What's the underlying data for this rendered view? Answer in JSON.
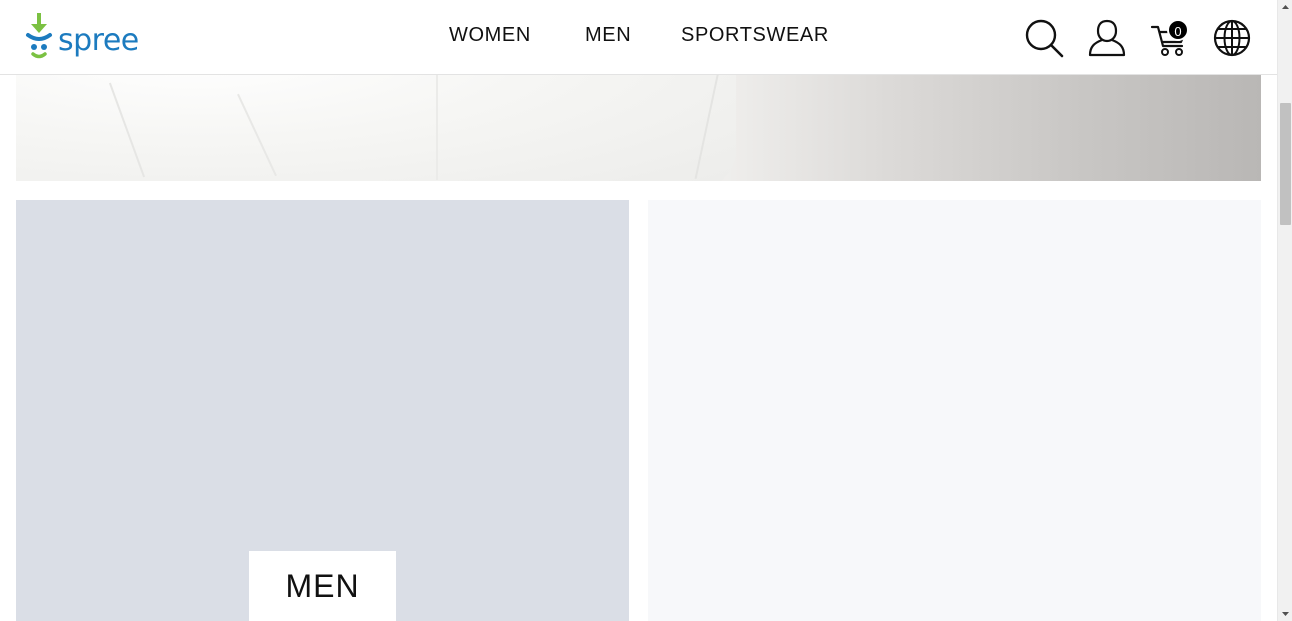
{
  "header": {
    "logo_text": "spree",
    "nav": [
      {
        "label": "WOMEN"
      },
      {
        "label": "MEN"
      },
      {
        "label": "SPORTSWEAR"
      }
    ],
    "icons": {
      "search": "search-icon",
      "account": "account-icon",
      "cart": "cart-icon",
      "language": "globe-icon"
    },
    "cart_count": "0"
  },
  "categories": [
    {
      "label": "MEN",
      "background": "#dadee6"
    },
    {
      "label": "",
      "background": "#f7f8fa"
    }
  ],
  "colors": {
    "brand_blue": "#1c7bbf",
    "brand_green": "#7bc142",
    "text": "#111111"
  }
}
